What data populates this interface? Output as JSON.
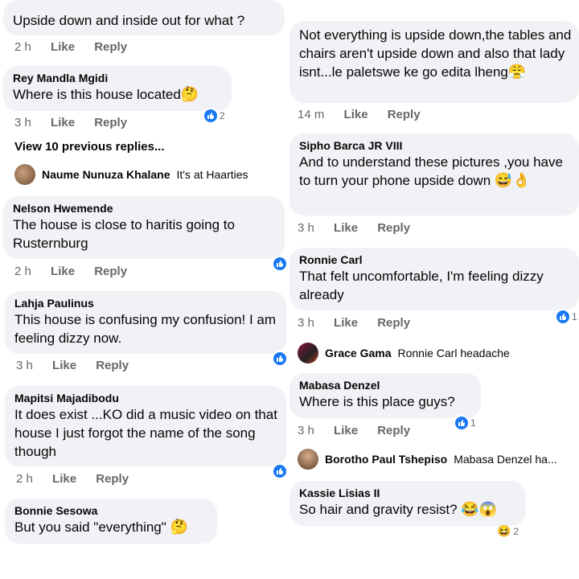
{
  "left": {
    "c1": {
      "text": "Upside down and inside out for what ?",
      "time": "2 h",
      "like": "Like",
      "reply": "Reply"
    },
    "c2": {
      "author": "Rey Mandla Mgidi",
      "text": "Where is this house located",
      "emoji": "🤔",
      "reactions": "2",
      "time": "3 h",
      "like": "Like",
      "reply": "Reply"
    },
    "view_more": "View 10 previous replies...",
    "r1": {
      "author": "Naume Nunuza Khalane",
      "text": "It's at Haarties"
    },
    "c3": {
      "author": "Nelson Hwemende",
      "text": "The house is close to haritis going to Rusternburg",
      "time": "2 h",
      "like": "Like",
      "reply": "Reply"
    },
    "c4": {
      "author": "Lahja Paulinus",
      "text": "This house is confusing my confusion! I am feeling dizzy now.",
      "time": "3 h",
      "like": "Like",
      "reply": "Reply"
    },
    "c5": {
      "author": "Mapitsi Majadibodu",
      "text": "It does exist ...KO did a music video on that house I just forgot the name of the song though",
      "time": "2 h",
      "like": "Like",
      "reply": "Reply"
    },
    "c6": {
      "author": "Bonnie Sesowa",
      "text": "But you said \"everything\"",
      "emoji": "🤔"
    }
  },
  "right": {
    "c1": {
      "text": "Not everything is upside down,the tables and chairs aren't upside down and also that lady isnt...le paletswe ke go edita lheng",
      "emoji": "😤",
      "time": "14 m",
      "like": "Like",
      "reply": "Reply"
    },
    "c2": {
      "author": "Sipho Barca JR VIII",
      "text": "And to understand these pictures ,you have to turn your phone upside down",
      "emoji": "😅👌",
      "time": "3 h",
      "like": "Like",
      "reply": "Reply"
    },
    "c3": {
      "author": "Ronnie Carl",
      "text": "That felt uncomfortable, I'm feeling dizzy already",
      "reactions": "1",
      "time": "3 h",
      "like": "Like",
      "reply": "Reply"
    },
    "r1": {
      "author": "Grace Gama",
      "text": "Ronnie Carl headache"
    },
    "c4": {
      "author": "Mabasa Denzel",
      "text": "Where is this place guys?",
      "reactions": "1",
      "time": "3 h",
      "like": "Like",
      "reply": "Reply"
    },
    "r2": {
      "author": "Borotho Paul Tshepiso",
      "text": "Mabasa Denzel ha..."
    },
    "c5": {
      "author": "Kassie Lisias II",
      "text": "So hair and gravity resist?",
      "emoji": "😂😱",
      "reactions": "2"
    }
  },
  "colors": {
    "bubble": "#f0f2f5",
    "like_blue": "#1877f2",
    "meta_gray": "#65676b"
  }
}
